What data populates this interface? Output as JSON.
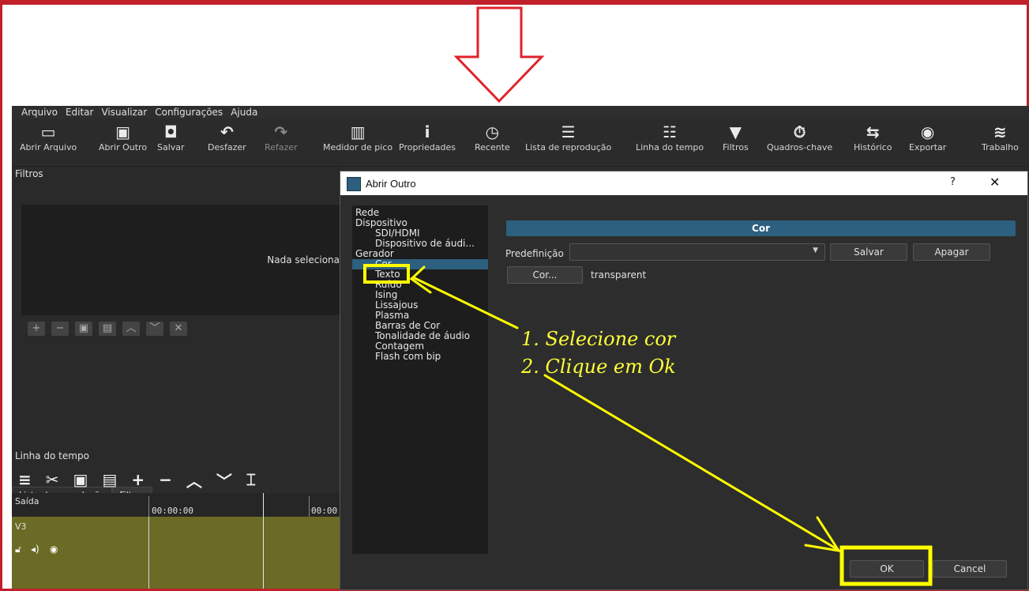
{
  "colors": {
    "accent": "#2d5f7e",
    "annotation": "#ffff00",
    "frame": "#c0202a",
    "track": "#6b6b25"
  },
  "menubar": {
    "items": [
      "Arquivo",
      "Editar",
      "Visualizar",
      "Configurações",
      "Ajuda"
    ]
  },
  "toolbar": {
    "abrir_arquivo": "Abrir Arquivo",
    "abrir_outro": "Abrir Outro",
    "salvar": "Salvar",
    "desfazer": "Desfazer",
    "refazer": "Refazer",
    "medidor": "Medidor de pico",
    "propriedades": "Propriedades",
    "recente": "Recente",
    "lista": "Lista de reprodução",
    "linha": "Linha do tempo",
    "filtros": "Filtros",
    "quadros": "Quadros-chave",
    "historico": "Histórico",
    "exportar": "Exportar",
    "trabalho": "Trabalho"
  },
  "filters_panel": {
    "title": "Filtros",
    "empty_text": "Nada seleciona"
  },
  "tabs": {
    "lista": "Lista de reprodução",
    "filtros": "Filtros"
  },
  "timeline": {
    "title": "Linha do tempo",
    "output_label": "Saída",
    "timecodes": [
      "00:00:00",
      "00:00"
    ],
    "track_name": "V3"
  },
  "dialog": {
    "title": "Abrir Outro",
    "help": "?",
    "close": "✕",
    "tree": {
      "rede": "Rede",
      "dispositivo": "Dispositivo",
      "sdi": "SDI/HDMI",
      "audio_device": "Dispositivo de áudi...",
      "gerador": "Gerador",
      "cor": "Cor",
      "texto": "Texto",
      "ruido": "Ruído",
      "ising": "Ising",
      "lissajous": "Lissajous",
      "plasma": "Plasma",
      "barras": "Barras de Cor",
      "tonalidade": "Tonalidade de áudio",
      "contagem": "Contagem",
      "flash": "Flash com bip"
    },
    "section_title": "Cor",
    "preset_label": "Predefinição",
    "preset_value": "",
    "save_button": "Salvar",
    "delete_button": "Apagar",
    "color_button": "Cor...",
    "color_value": "transparent",
    "ok_button": "OK",
    "cancel_button": "Cancel"
  },
  "annotations": {
    "step1": "1. Selecione cor",
    "step2": "2. Clique em Ok"
  }
}
